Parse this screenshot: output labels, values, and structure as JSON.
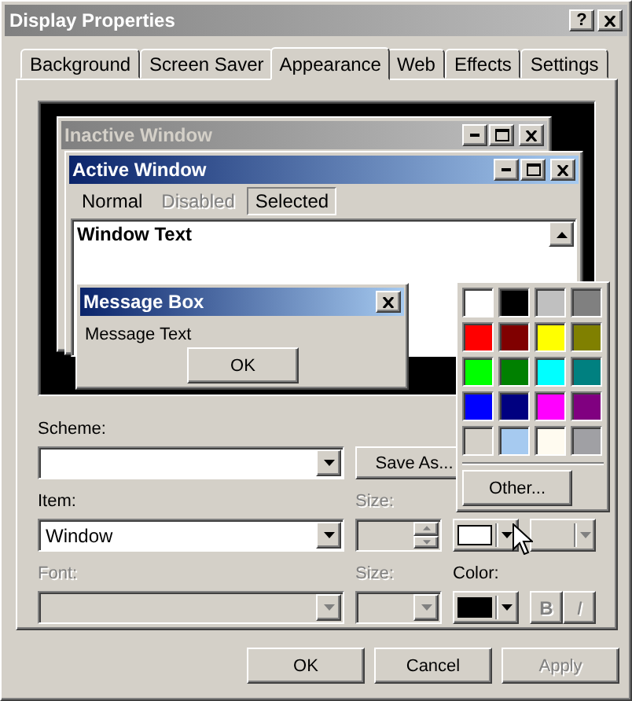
{
  "window": {
    "title": "Display Properties",
    "help": "?"
  },
  "tabs": [
    {
      "label": "Background",
      "selected": false
    },
    {
      "label": "Screen Saver",
      "selected": false
    },
    {
      "label": "Appearance",
      "selected": true
    },
    {
      "label": "Web",
      "selected": false
    },
    {
      "label": "Effects",
      "selected": false
    },
    {
      "label": "Settings",
      "selected": false
    }
  ],
  "preview": {
    "inactive_window": {
      "title": "Inactive Window"
    },
    "active_window": {
      "title": "Active Window",
      "menu": [
        {
          "label": "Normal",
          "kind": "normal"
        },
        {
          "label": "Disabled",
          "kind": "disabled"
        },
        {
          "label": "Selected",
          "kind": "selected"
        }
      ],
      "text": "Window Text"
    },
    "message_box": {
      "title": "Message Box",
      "text": "Message Text",
      "button": "OK"
    }
  },
  "scheme": {
    "label": "Scheme:",
    "save_as": "Save As..."
  },
  "item": {
    "label": "Item:",
    "value": "Window",
    "size": {
      "label": "Size:",
      "disabled": true
    },
    "color": "#ffffff",
    "color_2": {
      "disabled": true
    }
  },
  "font": {
    "label": "Font:",
    "disabled": true,
    "size": {
      "label": "Size:",
      "disabled": true
    },
    "color_label": "Color:",
    "color": "#000000",
    "bold": {
      "label": "B",
      "disabled": true
    },
    "italic": {
      "label": "I",
      "disabled": true
    }
  },
  "palette": {
    "swatches": [
      {
        "color": "#ffffff"
      },
      {
        "color": "#000000"
      },
      {
        "color": "#c0c0c0"
      },
      {
        "color": "#808080"
      },
      {
        "color": "#ff0000"
      },
      {
        "color": "#800000"
      },
      {
        "color": "#ffff00"
      },
      {
        "color": "#808000"
      },
      {
        "color": "#00ff00"
      },
      {
        "color": "#008000"
      },
      {
        "color": "#00ffff"
      },
      {
        "color": "#008080"
      },
      {
        "color": "#0000ff"
      },
      {
        "color": "#000080"
      },
      {
        "color": "#ff00ff"
      },
      {
        "color": "#800080"
      },
      {
        "color": "#d4d0c8"
      },
      {
        "color": "#a6caf0"
      },
      {
        "color": "#fffbf0"
      },
      {
        "color": "#a0a0a4"
      }
    ],
    "other": "Other..."
  },
  "buttons": [
    {
      "label": "OK",
      "disabled": false
    },
    {
      "label": "Cancel",
      "disabled": false
    },
    {
      "label": "Apply",
      "disabled": true
    }
  ]
}
